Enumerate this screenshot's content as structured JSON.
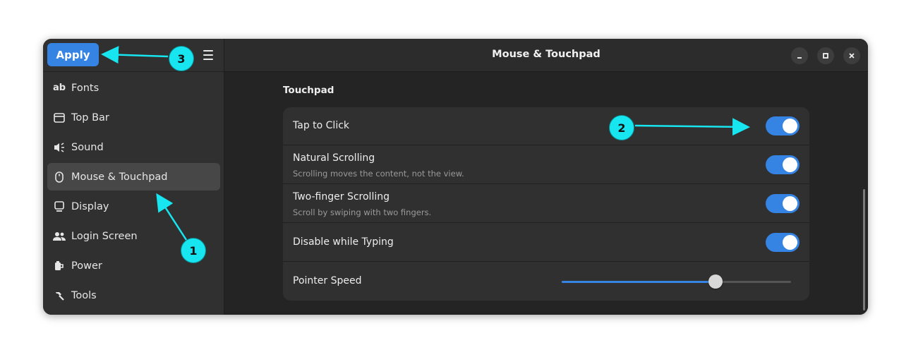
{
  "window": {
    "title": "Mouse & Touchpad"
  },
  "header": {
    "apply_label": "Apply"
  },
  "sidebar": {
    "items": [
      {
        "label": "Fonts",
        "icon": "font-icon"
      },
      {
        "label": "Top Bar",
        "icon": "top-bar-icon"
      },
      {
        "label": "Sound",
        "icon": "sound-icon"
      },
      {
        "label": "Mouse & Touchpad",
        "icon": "mouse-icon",
        "active": true
      },
      {
        "label": "Display",
        "icon": "display-icon"
      },
      {
        "label": "Login Screen",
        "icon": "login-icon"
      },
      {
        "label": "Power",
        "icon": "power-icon"
      },
      {
        "label": "Tools",
        "icon": "tools-icon"
      }
    ]
  },
  "main": {
    "section_title": "Touchpad",
    "rows": [
      {
        "label": "Tap to Click",
        "enabled": true
      },
      {
        "label": "Natural Scrolling",
        "subtitle": "Scrolling moves the content, not the view.",
        "enabled": true
      },
      {
        "label": "Two-finger Scrolling",
        "subtitle": "Scroll by swiping with two fingers.",
        "enabled": true
      },
      {
        "label": "Disable while Typing",
        "enabled": true
      },
      {
        "label": "Pointer Speed",
        "slider_fraction": 0.67
      }
    ]
  },
  "annotations": [
    "1",
    "2",
    "3"
  ],
  "colors": {
    "accent": "#3584e4",
    "annotation": "#17e6f0",
    "window_bg": "#242424",
    "sidebar_bg": "#303030"
  }
}
